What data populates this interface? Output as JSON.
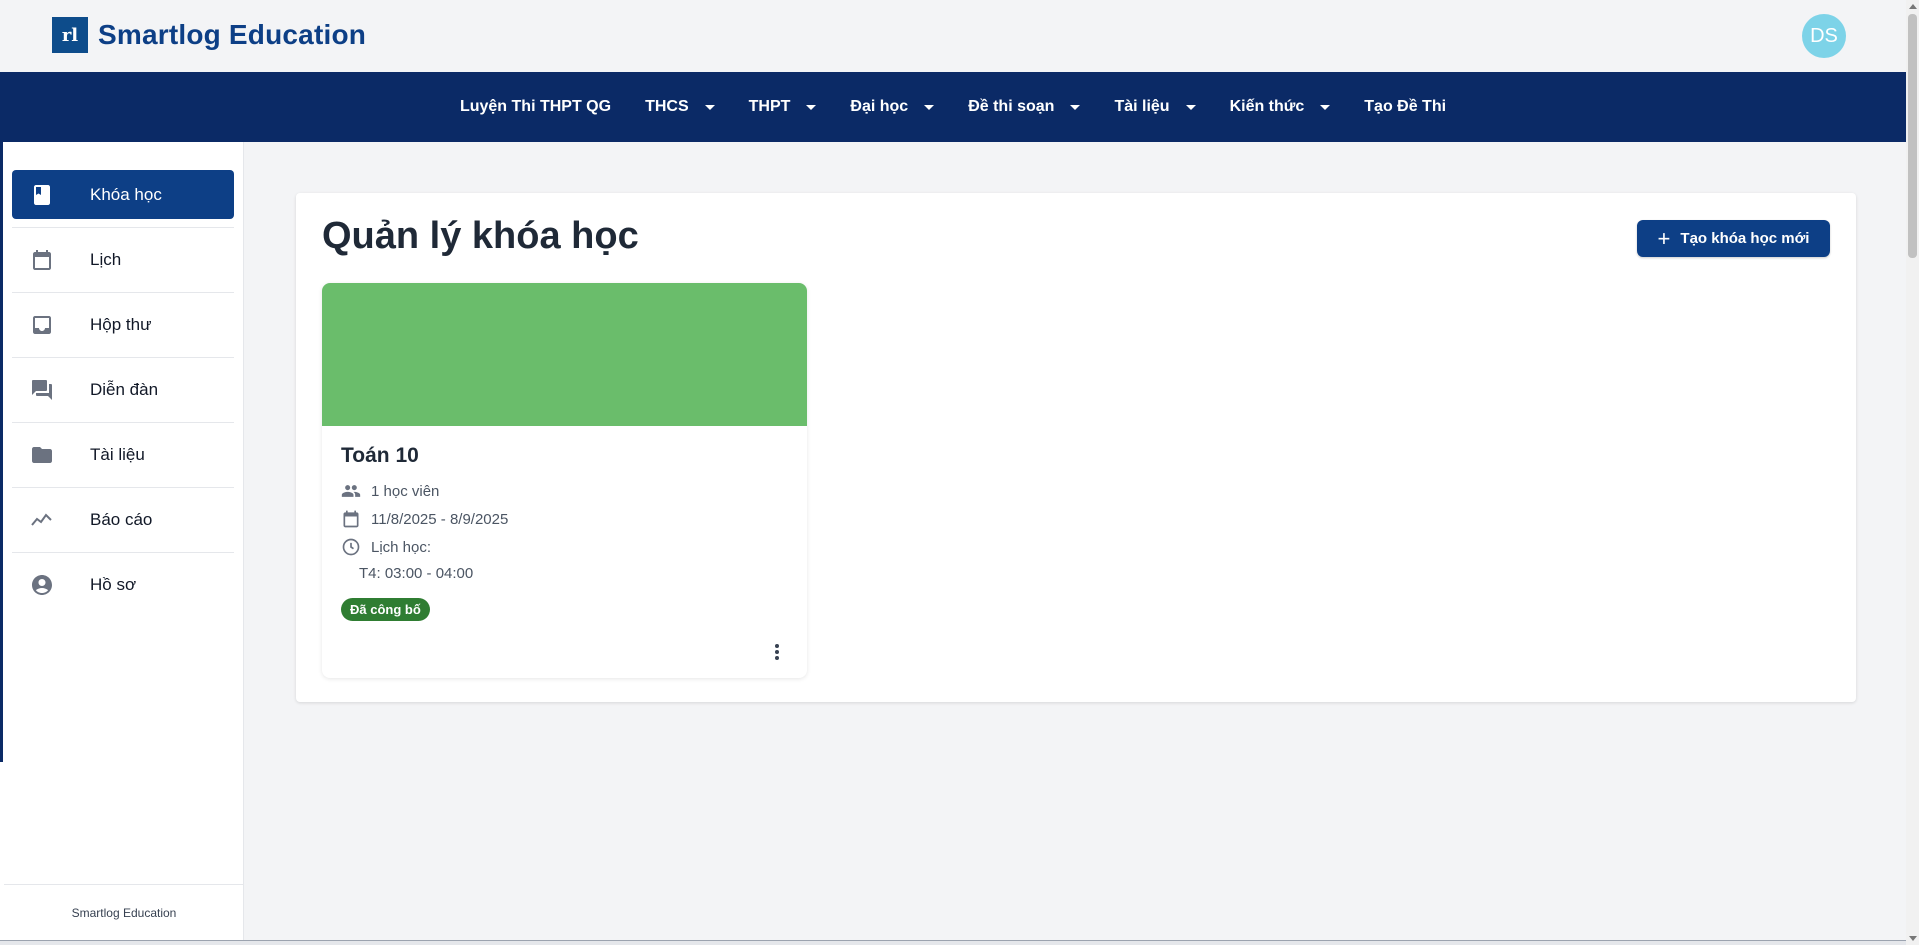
{
  "header": {
    "logo_mark": "rl",
    "brand": "Smartlog Education",
    "avatar_initials": "DS"
  },
  "nav": {
    "items": [
      {
        "label": "Luyện Thi THPT QG",
        "has_dropdown": false
      },
      {
        "label": "THCS",
        "has_dropdown": true
      },
      {
        "label": "THPT",
        "has_dropdown": true
      },
      {
        "label": "Đại học",
        "has_dropdown": true
      },
      {
        "label": "Đề thi soạn",
        "has_dropdown": true
      },
      {
        "label": "Tài liệu",
        "has_dropdown": true
      },
      {
        "label": "Kiến thức",
        "has_dropdown": true
      },
      {
        "label": "Tạo Đề Thi",
        "has_dropdown": false
      }
    ]
  },
  "sidebar": {
    "items": [
      {
        "label": "Khóa học",
        "icon": "book-icon",
        "active": true
      },
      {
        "label": "Lịch",
        "icon": "calendar-icon",
        "active": false
      },
      {
        "label": "Hộp thư",
        "icon": "inbox-icon",
        "active": false
      },
      {
        "label": "Diễn đàn",
        "icon": "forum-icon",
        "active": false
      },
      {
        "label": "Tài liệu",
        "icon": "folder-icon",
        "active": false
      },
      {
        "label": "Báo cáo",
        "icon": "trending-icon",
        "active": false
      },
      {
        "label": "Hồ sơ",
        "icon": "account-circle-icon",
        "active": false
      }
    ],
    "footer": "Smartlog Education"
  },
  "main": {
    "title": "Quản lý khóa học",
    "create_button": "Tạo khóa học mới",
    "courses": [
      {
        "title": "Toán 10",
        "students": "1 học viên",
        "date_range": "11/8/2025 - 8/9/2025",
        "schedule_label": "Lịch học:",
        "schedule": "T4: 03:00 - 04:00",
        "status": "Đã công bố",
        "cover_color": "#6abd6b"
      }
    ]
  },
  "colors": {
    "primary": "#0d3f86",
    "navbar": "#0b2a66",
    "published": "#2f7d32"
  }
}
